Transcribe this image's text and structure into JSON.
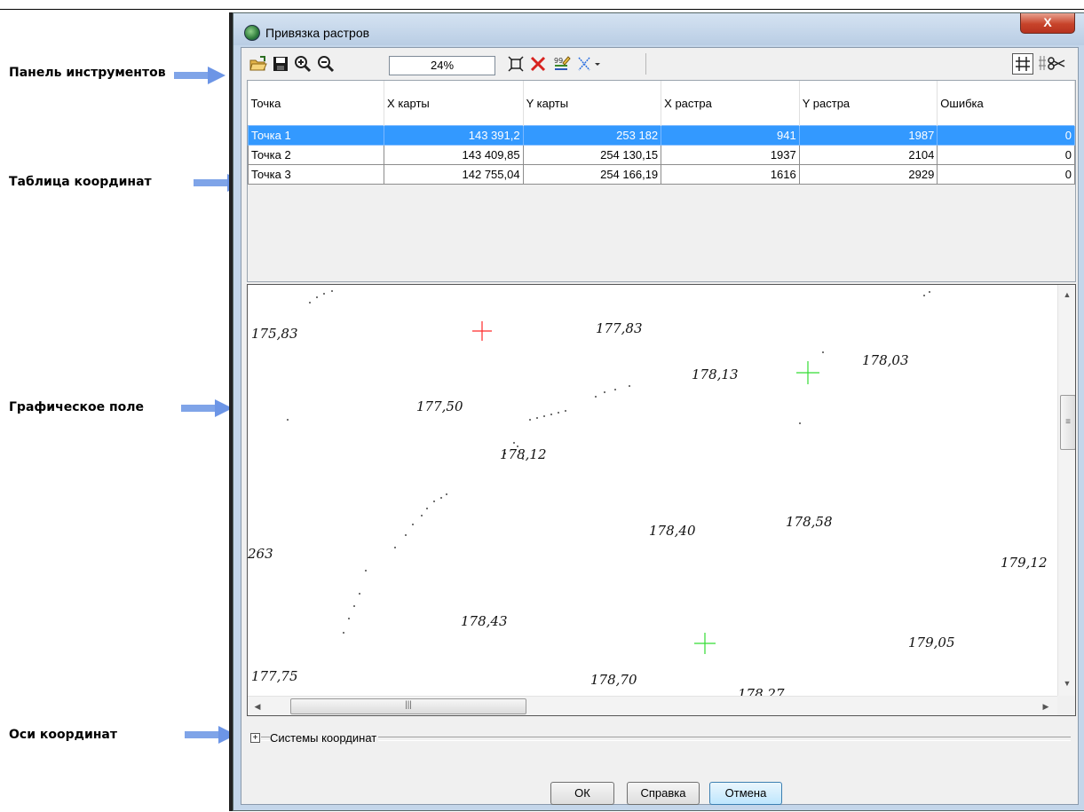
{
  "window": {
    "title": "Привязка растров",
    "close_label": "X"
  },
  "annotations": [
    {
      "label": "Панель инструментов"
    },
    {
      "label": "Таблица координат"
    },
    {
      "label": "Графическое поле"
    },
    {
      "label": "Оси координат"
    }
  ],
  "toolbar": {
    "zoom_value": "24%",
    "icons": [
      "open-icon",
      "save-icon",
      "zoom-in-icon",
      "zoom-out-icon",
      "fit-icon",
      "delete-point-icon",
      "edit-points-icon",
      "cross-marker-icon",
      "grid-toggle-icon",
      "split-icon"
    ]
  },
  "table": {
    "columns": [
      "Точка",
      "X карты",
      "Y карты",
      "X растра",
      "Y растра",
      "Ошибка"
    ],
    "rows": [
      [
        "Точка 1",
        "143 391,2",
        "253 182",
        "941",
        "1987",
        "0"
      ],
      [
        "Точка 2",
        "143 409,85",
        "254 130,15",
        "1937",
        "2104",
        "0"
      ],
      [
        "Точка 3",
        "142 755,04",
        "254 166,19",
        "1616",
        "2929",
        "0"
      ]
    ],
    "selected_row": 0
  },
  "map": {
    "labels": [
      "175,83",
      "177,83",
      "178,13",
      "178,03",
      "177,50",
      "178,12",
      "178,40",
      "178,58",
      "263",
      "179,12",
      "178,43",
      "179,05",
      "177,75",
      "178,70",
      "178,27"
    ],
    "marker_colors": {
      "red": "#ff2a2a",
      "green": "#33dd33"
    }
  },
  "coord_systems": {
    "expander": "+",
    "label": "Системы координат"
  },
  "buttons": {
    "ok": "ОК",
    "help": "Справка",
    "cancel": "Отмена"
  },
  "colors": {
    "selection": "#3399ff",
    "arrow": "#7fa4e8",
    "titlebar": "#c4d6ea",
    "close_button": "#c7432a"
  }
}
